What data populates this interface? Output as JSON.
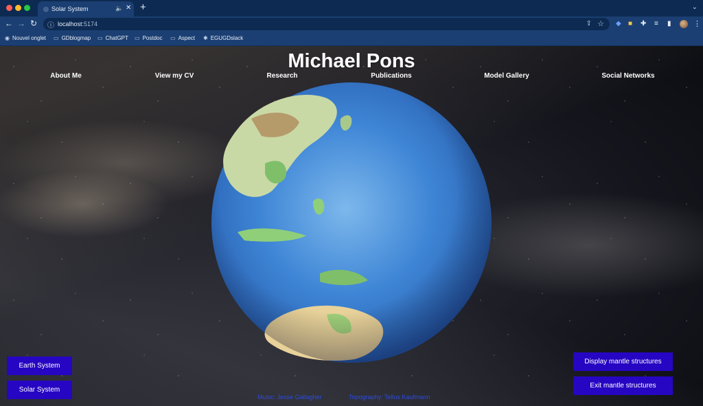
{
  "browser": {
    "tab_title": "Solar System",
    "url_host": "localhost",
    "url_port": ":5174",
    "bookmarks": [
      {
        "label": "Nouvel onglet",
        "icon": "globe-icon"
      },
      {
        "label": "GDblogmap",
        "icon": "folder-icon"
      },
      {
        "label": "ChatGPT",
        "icon": "folder-icon"
      },
      {
        "label": "Postdoc",
        "icon": "folder-icon"
      },
      {
        "label": "Aspect",
        "icon": "folder-icon"
      },
      {
        "label": "EGUGDslack",
        "icon": "slack-icon"
      }
    ],
    "colors": {
      "chrome_dark": "#0d2a52",
      "chrome": "#1b3f72"
    }
  },
  "page": {
    "title": "Michael Pons",
    "nav": [
      {
        "label": "About Me"
      },
      {
        "label": "View my CV"
      },
      {
        "label": "Research"
      },
      {
        "label": "Publications"
      },
      {
        "label": "Model Gallery"
      },
      {
        "label": "Social Networks"
      }
    ],
    "left_buttons": [
      {
        "label": "Earth System"
      },
      {
        "label": "Solar System"
      }
    ],
    "right_buttons": [
      {
        "label": "Display mantle structures"
      },
      {
        "label": "Exit mantle structures"
      }
    ],
    "credits": [
      {
        "label": "Music: Jesse Gallagher"
      },
      {
        "label": "Topography: Tellus Kaufmann"
      }
    ],
    "globe": "earth-topography-globe",
    "colors": {
      "button": "#2606c2",
      "credit_link": "#2d4be0",
      "ocean": "#3f86d6"
    }
  }
}
